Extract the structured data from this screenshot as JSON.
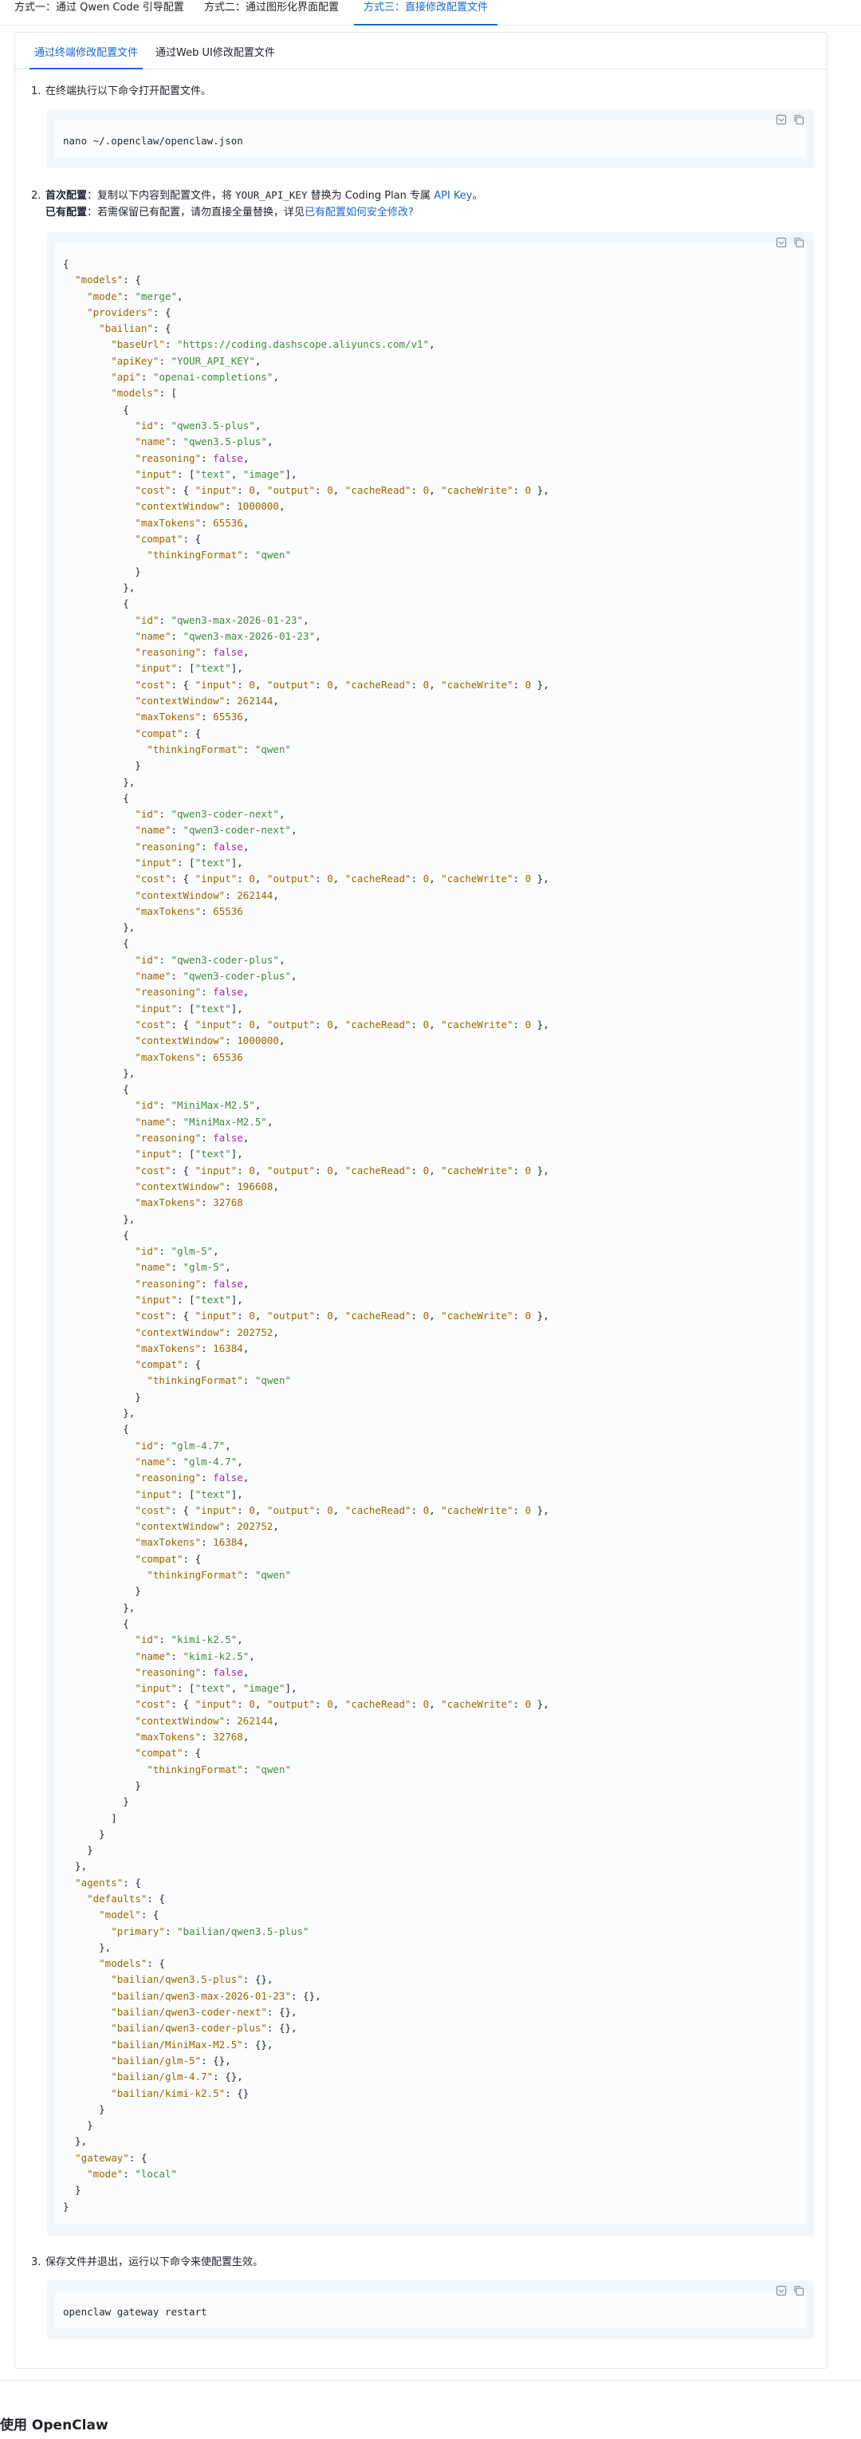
{
  "top_tabs": [
    {
      "label": "方式一：通过 Qwen Code 引导配置",
      "active": false
    },
    {
      "label": "方式二：通过图形化界面配置",
      "active": false
    },
    {
      "label": "方式三：直接修改配置文件",
      "active": true
    }
  ],
  "sub_tabs": [
    {
      "label": "通过终端修改配置文件",
      "active": true
    },
    {
      "label": "通过Web UI修改配置文件",
      "active": false
    }
  ],
  "step1": {
    "num": "1.",
    "text": "在终端执行以下命令打开配置文件。"
  },
  "step1_code": "nano ~/.openclaw/openclaw.json",
  "step2": {
    "num": "2.",
    "first_bold": "首次配置",
    "first_text_a": "：复制以下内容到配置文件，将 ",
    "first_code": "YOUR_API_KEY",
    "first_text_b": " 替换为 Coding Plan 专属 ",
    "first_link": "API Key",
    "first_text_c": "。",
    "existing_bold": "已有配置",
    "existing_text": "：若需保留已有配置，请勿直接全量替换，详见",
    "existing_link": "已有配置如何安全修改?"
  },
  "step3": {
    "num": "3.",
    "text": "保存文件并退出，运行以下命令来使配置生效。"
  },
  "step3_code": "openclaw gateway restart",
  "section_title": "使用 OpenClaw",
  "icons": {
    "code_block": [
      "download-icon",
      "copy-icon"
    ]
  },
  "colors": {
    "accent": "#1967d2",
    "key": "#986801",
    "string": "#3e8b3e",
    "boolean": "#a626a4"
  },
  "json_config": {
    "models": {
      "mode": "merge",
      "providers": {
        "bailian": {
          "baseUrl": "https://coding.dashscope.aliyuncs.com/v1",
          "apiKey": "YOUR_API_KEY",
          "api": "openai-completions",
          "models": [
            {
              "id": "qwen3.5-plus",
              "name": "qwen3.5-plus",
              "reasoning": false,
              "input": [
                "text",
                "image"
              ],
              "cost": {
                "input": 0,
                "output": 0,
                "cacheRead": 0,
                "cacheWrite": 0
              },
              "contextWindow": 1000000,
              "maxTokens": 65536,
              "compat": {
                "thinkingFormat": "qwen"
              }
            },
            {
              "id": "qwen3-max-2026-01-23",
              "name": "qwen3-max-2026-01-23",
              "reasoning": false,
              "input": [
                "text"
              ],
              "cost": {
                "input": 0,
                "output": 0,
                "cacheRead": 0,
                "cacheWrite": 0
              },
              "contextWindow": 262144,
              "maxTokens": 65536,
              "compat": {
                "thinkingFormat": "qwen"
              }
            },
            {
              "id": "qwen3-coder-next",
              "name": "qwen3-coder-next",
              "reasoning": false,
              "input": [
                "text"
              ],
              "cost": {
                "input": 0,
                "output": 0,
                "cacheRead": 0,
                "cacheWrite": 0
              },
              "contextWindow": 262144,
              "maxTokens": 65536
            },
            {
              "id": "qwen3-coder-plus",
              "name": "qwen3-coder-plus",
              "reasoning": false,
              "input": [
                "text"
              ],
              "cost": {
                "input": 0,
                "output": 0,
                "cacheRead": 0,
                "cacheWrite": 0
              },
              "contextWindow": 1000000,
              "maxTokens": 65536
            },
            {
              "id": "MiniMax-M2.5",
              "name": "MiniMax-M2.5",
              "reasoning": false,
              "input": [
                "text"
              ],
              "cost": {
                "input": 0,
                "output": 0,
                "cacheRead": 0,
                "cacheWrite": 0
              },
              "contextWindow": 196608,
              "maxTokens": 32768
            },
            {
              "id": "glm-5",
              "name": "glm-5",
              "reasoning": false,
              "input": [
                "text"
              ],
              "cost": {
                "input": 0,
                "output": 0,
                "cacheRead": 0,
                "cacheWrite": 0
              },
              "contextWindow": 202752,
              "maxTokens": 16384,
              "compat": {
                "thinkingFormat": "qwen"
              }
            },
            {
              "id": "glm-4.7",
              "name": "glm-4.7",
              "reasoning": false,
              "input": [
                "text"
              ],
              "cost": {
                "input": 0,
                "output": 0,
                "cacheRead": 0,
                "cacheWrite": 0
              },
              "contextWindow": 202752,
              "maxTokens": 16384,
              "compat": {
                "thinkingFormat": "qwen"
              }
            },
            {
              "id": "kimi-k2.5",
              "name": "kimi-k2.5",
              "reasoning": false,
              "input": [
                "text",
                "image"
              ],
              "cost": {
                "input": 0,
                "output": 0,
                "cacheRead": 0,
                "cacheWrite": 0
              },
              "contextWindow": 262144,
              "maxTokens": 32768,
              "compat": {
                "thinkingFormat": "qwen"
              }
            }
          ]
        }
      }
    },
    "agents": {
      "defaults": {
        "model": {
          "primary": "bailian/qwen3.5-plus"
        },
        "models": {
          "bailian/qwen3.5-plus": {},
          "bailian/qwen3-max-2026-01-23": {},
          "bailian/qwen3-coder-next": {},
          "bailian/qwen3-coder-plus": {},
          "bailian/MiniMax-M2.5": {},
          "bailian/glm-5": {},
          "bailian/glm-4.7": {},
          "bailian/kimi-k2.5": {}
        }
      }
    },
    "gateway": {
      "mode": "local"
    }
  }
}
